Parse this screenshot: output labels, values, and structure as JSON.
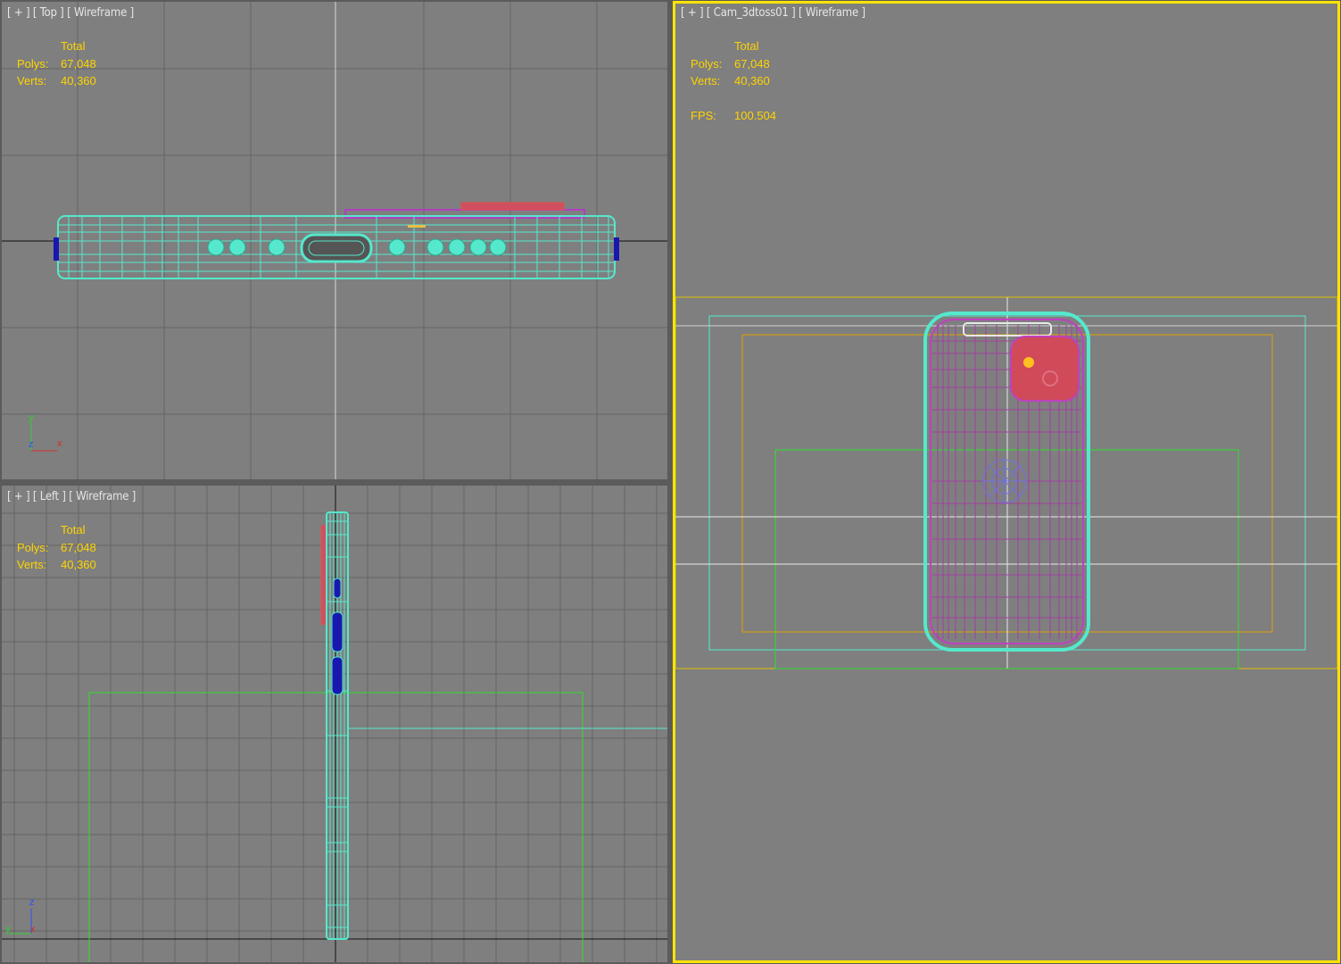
{
  "viewports": {
    "top": {
      "label_parts": [
        "[ + ]",
        "[ Top ]",
        "[ Wireframe ]"
      ],
      "stats": {
        "header": "Total",
        "polys_label": "Polys:",
        "polys": "67,048",
        "verts_label": "Verts:",
        "verts": "40,360"
      },
      "gizmo": {
        "up": "y",
        "mid": "z",
        "right": "x"
      }
    },
    "left": {
      "label_parts": [
        "[ + ]",
        "[ Left ]",
        "[ Wireframe ]"
      ],
      "stats": {
        "header": "Total",
        "polys_label": "Polys:",
        "polys": "67,048",
        "verts_label": "Verts:",
        "verts": "40,360"
      },
      "gizmo": {
        "up": "z",
        "mid": "x",
        "right": "y"
      }
    },
    "camera": {
      "label_parts": [
        "[ + ]",
        "[ Cam_3dtoss01 ]",
        "[ Wireframe ]"
      ],
      "stats": {
        "header": "Total",
        "polys_label": "Polys:",
        "polys": "67,048",
        "verts_label": "Verts:",
        "verts": "40,360",
        "fps_label": "FPS:",
        "fps": "100.504"
      },
      "active": true
    }
  },
  "colors": {
    "viewport_bg": "#7f7f7f",
    "grid": "#646464",
    "stats_text": "#ffd400",
    "active_border": "#ffe400",
    "wire_cyan": "#55e8cc",
    "wire_magenta": "#c040c0",
    "wire_red": "#e05050",
    "wire_blue": "#1818b0",
    "frame_green": "#2ee02e",
    "frame_orange": "#e0a000"
  }
}
